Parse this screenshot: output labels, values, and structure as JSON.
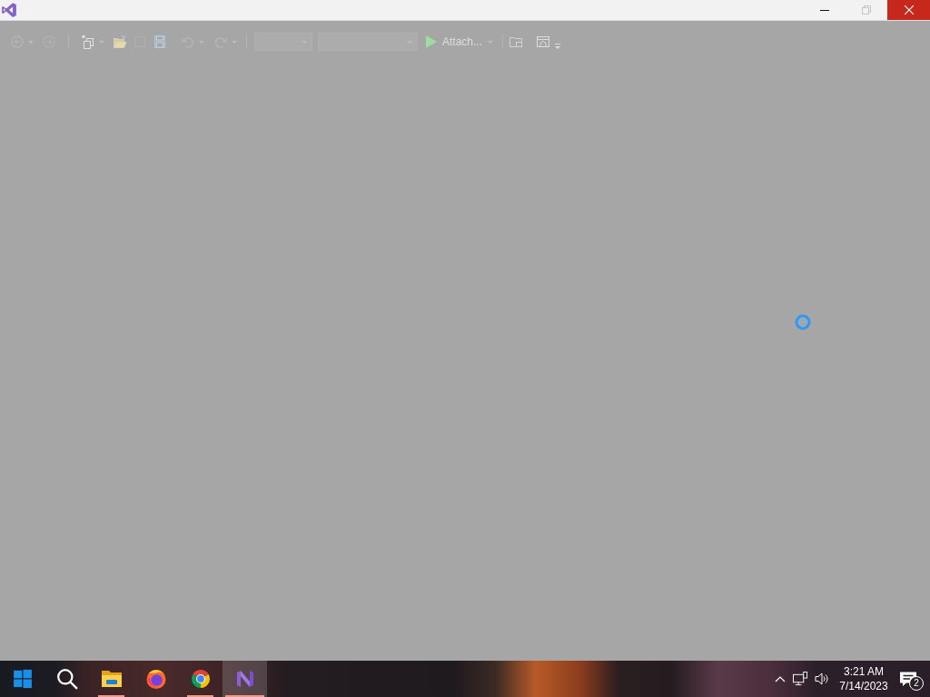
{
  "title_bar": {
    "window_controls": [
      {
        "kind": "minimize",
        "disabled": false
      },
      {
        "kind": "restore",
        "disabled": true
      },
      {
        "kind": "close",
        "disabled": false
      }
    ]
  },
  "toolbar": {
    "items": [
      {
        "kind": "back",
        "dropdown": true
      },
      {
        "kind": "forward",
        "dropdown": false
      },
      {
        "kind": "separator"
      },
      {
        "kind": "new",
        "dropdown": true
      },
      {
        "kind": "open",
        "dropdown": false
      },
      {
        "kind": "save",
        "dropdown": false
      },
      {
        "kind": "saveall",
        "dropdown": false
      },
      {
        "kind": "undo",
        "dropdown": true
      },
      {
        "kind": "redo",
        "dropdown": true
      },
      {
        "kind": "separator"
      },
      {
        "kind": "combo"
      },
      {
        "kind": "combo"
      },
      {
        "kind": "attach",
        "label": "Attach...",
        "dropdown": true
      },
      {
        "kind": "separator"
      },
      {
        "kind": "explorer",
        "dropdown": false
      },
      {
        "kind": "window",
        "dropdown": false
      },
      {
        "kind": "overflow"
      }
    ]
  },
  "taskbar": {
    "apps": [
      {
        "kind": "start",
        "running": false,
        "selected": false
      },
      {
        "kind": "search",
        "running": false,
        "selected": false
      },
      {
        "kind": "explorer",
        "running": true,
        "selected": false
      },
      {
        "kind": "firefox",
        "running": false,
        "selected": false
      },
      {
        "kind": "chrome",
        "running": true,
        "selected": false
      },
      {
        "kind": "studio",
        "running": true,
        "selected": true
      }
    ],
    "tray": {
      "icons": [
        {
          "kind": "chevron"
        },
        {
          "kind": "network"
        },
        {
          "kind": "volume"
        }
      ],
      "time": "3:21 AM",
      "date": "7/14/2023",
      "notifications": "2"
    }
  }
}
